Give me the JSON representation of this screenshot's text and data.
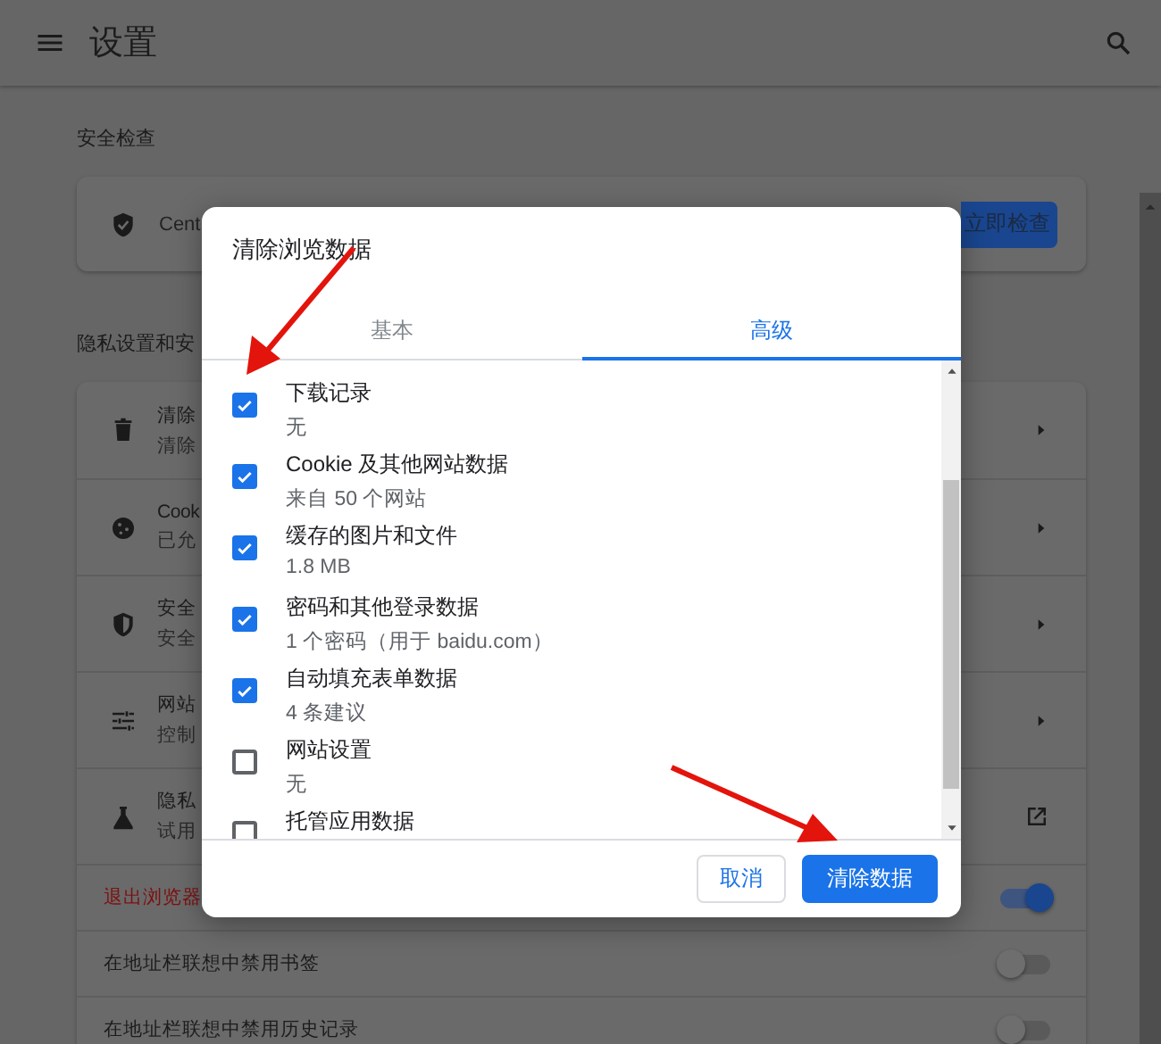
{
  "header": {
    "title": "设置"
  },
  "safety_check": {
    "heading": "安全检查",
    "text": "Cent",
    "button": "立即检查"
  },
  "privacy": {
    "heading": "隐私设置和安",
    "rows": [
      {
        "kind": "link",
        "title": "清除",
        "subtitle": "清除"
      },
      {
        "kind": "link",
        "title": "Cook",
        "subtitle": "已允"
      },
      {
        "kind": "link",
        "title": "安全",
        "subtitle": "安全"
      },
      {
        "kind": "link",
        "title": "网站",
        "subtitle": "控制"
      },
      {
        "kind": "external",
        "title": "隐私",
        "subtitle": "试用"
      }
    ],
    "toggles": [
      {
        "label": "退出浏览器",
        "on": true,
        "highlight": true
      },
      {
        "label": "在地址栏联想中禁用书签",
        "on": false,
        "highlight": false
      },
      {
        "label": "在地址栏联想中禁用历史记录",
        "on": false,
        "highlight": false
      }
    ]
  },
  "dialog": {
    "title": "清除浏览数据",
    "tabs": [
      {
        "label": "基本",
        "selected": false
      },
      {
        "label": "高级",
        "selected": true
      }
    ],
    "items": [
      {
        "label": "下载记录",
        "detail": "无",
        "checked": true
      },
      {
        "label": "Cookie 及其他网站数据",
        "detail": "来自 50 个网站",
        "checked": true
      },
      {
        "label": "缓存的图片和文件",
        "detail": "1.8 MB",
        "checked": true
      },
      {
        "label": "密码和其他登录数据",
        "detail": "1 个密码（用于 baidu.com）",
        "checked": true
      },
      {
        "label": "自动填充表单数据",
        "detail": "4 条建议",
        "checked": true
      },
      {
        "label": "网站设置",
        "detail": "无",
        "checked": false
      },
      {
        "label": "托管应用数据",
        "checked": false
      }
    ],
    "buttons": [
      {
        "kind": "secondary",
        "label": "取消"
      },
      {
        "kind": "primary",
        "label": "清除数据"
      }
    ]
  }
}
